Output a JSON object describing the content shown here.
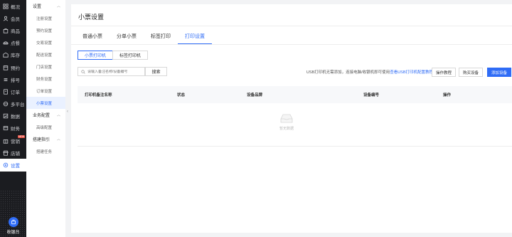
{
  "nav": {
    "items": [
      {
        "label": "概况",
        "icon": "grid-icon"
      },
      {
        "label": "会员",
        "icon": "member-icon"
      },
      {
        "label": "商品",
        "icon": "goods-icon"
      },
      {
        "label": "点餐",
        "icon": "order-food-icon"
      },
      {
        "label": "库存",
        "icon": "inventory-icon"
      },
      {
        "label": "预约",
        "icon": "reservation-icon"
      },
      {
        "label": "排号",
        "icon": "queue-icon"
      },
      {
        "label": "订单",
        "icon": "orders-icon"
      },
      {
        "label": "多平台",
        "icon": "multi-platform-icon"
      },
      {
        "label": "数据",
        "icon": "data-icon"
      },
      {
        "label": "财务",
        "icon": "finance-icon"
      },
      {
        "label": "营销",
        "icon": "marketing-icon",
        "badge": "NEW"
      },
      {
        "label": "店铺",
        "icon": "store-icon"
      },
      {
        "label": "设置",
        "icon": "settings-icon"
      }
    ],
    "cash_label": "收银台"
  },
  "submenu": {
    "groups": [
      {
        "title": "设置",
        "items": [
          "注册设置",
          "预约设置",
          "交易设置",
          "配送设置",
          "门店设置",
          "财务设置",
          "订单设置",
          "小票设置"
        ]
      },
      {
        "title": "业务配置",
        "items": [
          "高级配置"
        ]
      },
      {
        "title": "搭建指引",
        "items": [
          "搭建任务"
        ]
      }
    ]
  },
  "main": {
    "title": "小票设置",
    "tabs": [
      "普通小票",
      "分单小票",
      "标签打印",
      "打印设置"
    ],
    "active_tab": 3,
    "segments": [
      "小票打印机",
      "标签打印机"
    ],
    "search_placeholder": "请输入备注名称/设备编号",
    "search_button": "搜索",
    "usb_tip": "USB打印机无需添加，连接电脑/收银机即可使用",
    "usb_link": "查看USB打印机配置教程",
    "buttons": {
      "tutorial": "操作教程",
      "buy": "购买设备",
      "add": "添加设备"
    },
    "columns": [
      "打印机备注名称",
      "状态",
      "设备品牌",
      "设备编号",
      "操作"
    ],
    "empty_text": "暂无数据"
  },
  "colors": {
    "primary": "#2f6cf6",
    "nav_bg": "#1b1c20",
    "badge": "#e84a3c"
  }
}
